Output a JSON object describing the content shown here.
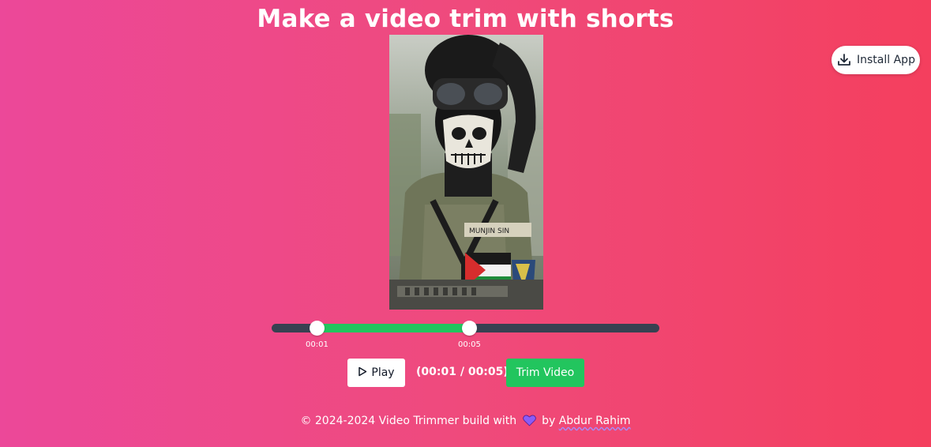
{
  "page": {
    "title": "Make a video trim with shorts"
  },
  "install": {
    "label": "Install App",
    "icon": "download-icon"
  },
  "video": {
    "description_icon": "video-preview"
  },
  "trimmer": {
    "start_label": "00:01",
    "end_label": "00:05",
    "start_fraction": 0.117,
    "end_fraction": 0.51
  },
  "controls": {
    "play_label": "Play",
    "play_icon": "play-icon",
    "time_display": "(00:01 / 00:05)",
    "trim_label": "Trim Video"
  },
  "footer": {
    "prefix": "© 2024-2024 Video Trimmer build with",
    "heart_icon": "heart-icon",
    "by": "by",
    "author": "Abdur Rahim"
  },
  "colors": {
    "gradient_start": "#ec4899",
    "gradient_end": "#f43f5e",
    "accent_green": "#22c55e",
    "track_dark": "#374151",
    "heart": "#8b5cf6"
  }
}
